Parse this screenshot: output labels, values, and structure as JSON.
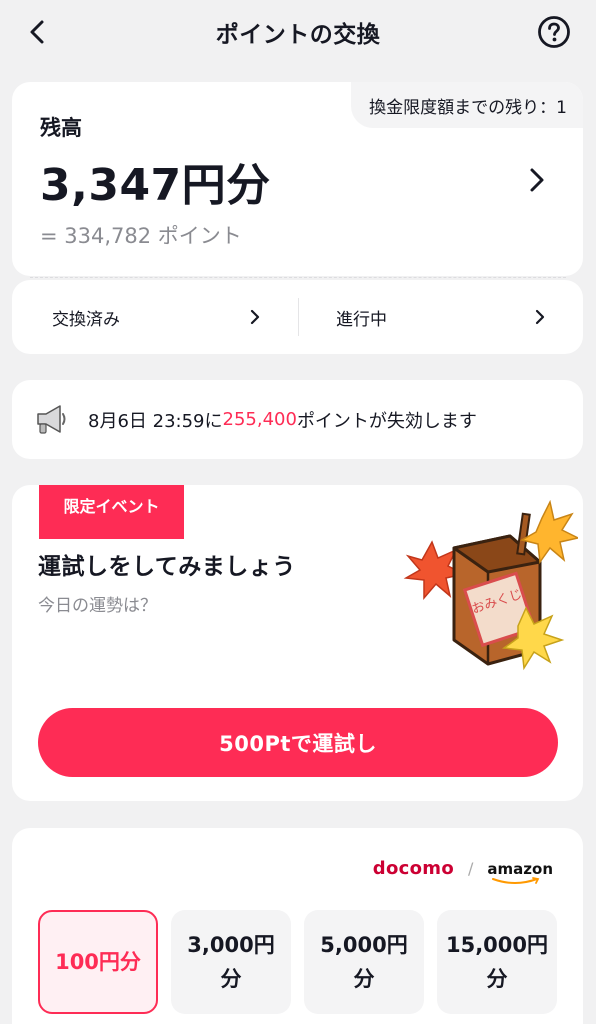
{
  "header": {
    "title": "ポイントの交換"
  },
  "balance": {
    "limit_text": "換金限度額までの残り：1",
    "label": "残高",
    "amount": "3,347円分",
    "points": "= 334,782 ポイント"
  },
  "history": {
    "exchanged_label": "交換済み",
    "in_progress_label": "進行中"
  },
  "notice": {
    "prefix": "8月6日 23:59に",
    "highlight": "255,400",
    "suffix": "ポイントが失効します"
  },
  "event": {
    "tag": "限定イベント",
    "title": "運試しをしてみましょう",
    "subtitle": "今日の運勢は？",
    "illustration_text": "おみくじ",
    "button_label": "500Ptで運試し"
  },
  "exchange": {
    "brands": [
      "docomo",
      "amazon"
    ],
    "brand_separator": "/",
    "amounts": [
      {
        "label": "100円分",
        "selected": true
      },
      {
        "label": "3,000円分",
        "selected": false
      },
      {
        "label": "5,000円分",
        "selected": false
      },
      {
        "label": "15,000円分",
        "selected": false
      }
    ]
  },
  "colors": {
    "accent": "#fe2c55",
    "background": "#f1f1f2",
    "docomo": "#cc0033"
  }
}
